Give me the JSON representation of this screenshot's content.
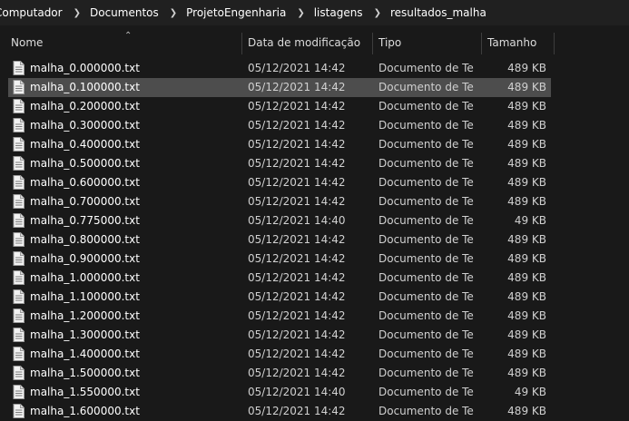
{
  "breadcrumb": [
    "Computador",
    "Documentos",
    "ProjetoEngenharia",
    "listagens",
    "resultados_malha"
  ],
  "icons": {
    "separator": "chevron-right-icon",
    "sort": "sort-up-chevron-icon",
    "file": "text-file-icon"
  },
  "columns": {
    "name": "Nome",
    "date": "Data de modificação",
    "type": "Tipo",
    "size": "Tamanho"
  },
  "files": [
    {
      "name": "malha_0.000000.txt",
      "date": "05/12/2021 14:42",
      "type": "Documento de Te...",
      "size": "489 KB"
    },
    {
      "name": "malha_0.100000.txt",
      "date": "05/12/2021 14:42",
      "type": "Documento de Te...",
      "size": "489 KB",
      "selected": true
    },
    {
      "name": "malha_0.200000.txt",
      "date": "05/12/2021 14:42",
      "type": "Documento de Te...",
      "size": "489 KB"
    },
    {
      "name": "malha_0.300000.txt",
      "date": "05/12/2021 14:42",
      "type": "Documento de Te...",
      "size": "489 KB"
    },
    {
      "name": "malha_0.400000.txt",
      "date": "05/12/2021 14:42",
      "type": "Documento de Te...",
      "size": "489 KB"
    },
    {
      "name": "malha_0.500000.txt",
      "date": "05/12/2021 14:42",
      "type": "Documento de Te...",
      "size": "489 KB"
    },
    {
      "name": "malha_0.600000.txt",
      "date": "05/12/2021 14:42",
      "type": "Documento de Te...",
      "size": "489 KB"
    },
    {
      "name": "malha_0.700000.txt",
      "date": "05/12/2021 14:42",
      "type": "Documento de Te...",
      "size": "489 KB"
    },
    {
      "name": "malha_0.775000.txt",
      "date": "05/12/2021 14:40",
      "type": "Documento de Te...",
      "size": "49 KB"
    },
    {
      "name": "malha_0.800000.txt",
      "date": "05/12/2021 14:42",
      "type": "Documento de Te...",
      "size": "489 KB"
    },
    {
      "name": "malha_0.900000.txt",
      "date": "05/12/2021 14:42",
      "type": "Documento de Te...",
      "size": "489 KB"
    },
    {
      "name": "malha_1.000000.txt",
      "date": "05/12/2021 14:42",
      "type": "Documento de Te...",
      "size": "489 KB"
    },
    {
      "name": "malha_1.100000.txt",
      "date": "05/12/2021 14:42",
      "type": "Documento de Te...",
      "size": "489 KB"
    },
    {
      "name": "malha_1.200000.txt",
      "date": "05/12/2021 14:42",
      "type": "Documento de Te...",
      "size": "489 KB"
    },
    {
      "name": "malha_1.300000.txt",
      "date": "05/12/2021 14:42",
      "type": "Documento de Te...",
      "size": "489 KB"
    },
    {
      "name": "malha_1.400000.txt",
      "date": "05/12/2021 14:42",
      "type": "Documento de Te...",
      "size": "489 KB"
    },
    {
      "name": "malha_1.500000.txt",
      "date": "05/12/2021 14:42",
      "type": "Documento de Te...",
      "size": "489 KB"
    },
    {
      "name": "malha_1.550000.txt",
      "date": "05/12/2021 14:40",
      "type": "Documento de Te...",
      "size": "49 KB"
    },
    {
      "name": "malha_1.600000.txt",
      "date": "05/12/2021 14:42",
      "type": "Documento de Te...",
      "size": "489 KB"
    }
  ]
}
